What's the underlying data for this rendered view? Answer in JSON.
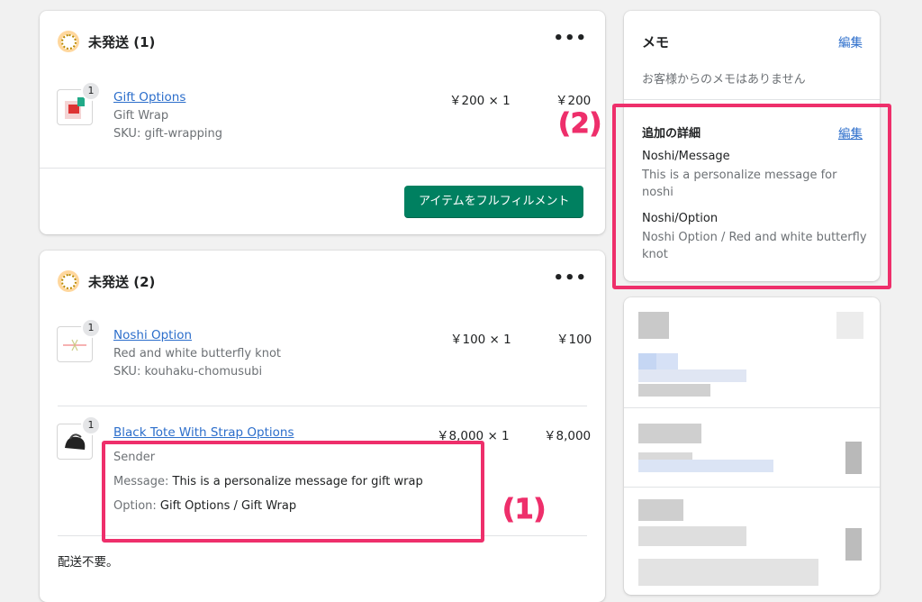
{
  "unfulfilled1": {
    "title": "未発送 (1)",
    "more": "•••",
    "item": {
      "qty": "1",
      "name": "Gift Options",
      "variant": "Gift Wrap",
      "sku": "SKU: gift-wrapping",
      "unit_price": "￥200 × 1",
      "total": "￥200"
    },
    "fulfill_button": "アイテムをフルフィルメント"
  },
  "unfulfilled2": {
    "title": "未発送 (2)",
    "more": "•••",
    "items": [
      {
        "qty": "1",
        "name": "Noshi Option",
        "variant": "Red and white butterfly knot",
        "sku": "SKU: kouhaku-chomusubi",
        "unit_price": "￥100 × 1",
        "total": "￥100"
      },
      {
        "qty": "1",
        "name": "Black Tote With Strap Options",
        "unit_price": "￥8,000 × 1",
        "total": "￥8,000",
        "props": {
          "sender": "Sender",
          "message_label": "Message:",
          "message_value": "This is a personalize message for gift wrap",
          "option_label": "Option:",
          "option_value": "Gift Options / Gift Wrap"
        }
      }
    ],
    "shipping_note": "配送不要。"
  },
  "memo": {
    "title": "メモ",
    "edit": "編集",
    "empty": "お客様からのメモはありません"
  },
  "details": {
    "title": "追加の詳細",
    "edit": "編集",
    "fields": [
      {
        "label": "Noshi/Message",
        "value": "This is a personalize message for noshi"
      },
      {
        "label": "Noshi/Option",
        "value": "Noshi Option / Red and white butterfly knot"
      }
    ]
  },
  "annotations": {
    "callout1": "(1)",
    "callout2": "(2)",
    "color": "#ee2f6b"
  }
}
